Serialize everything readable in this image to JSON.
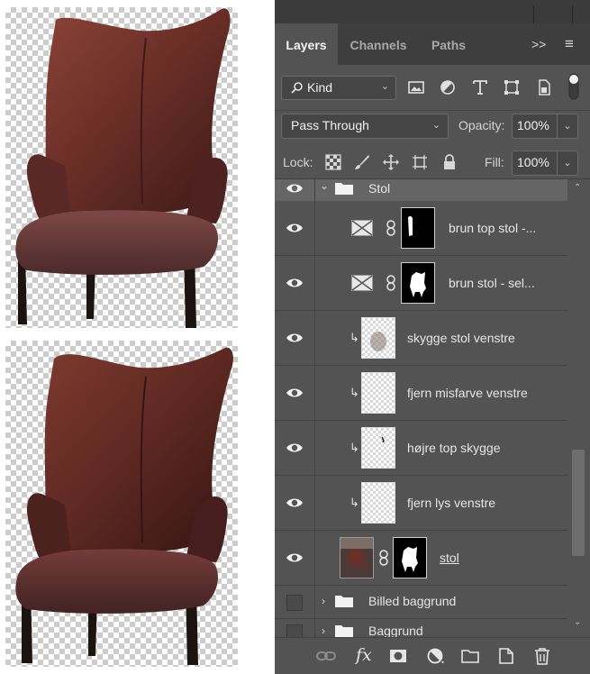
{
  "panel": {
    "tabs": [
      {
        "label": "Layers",
        "active": true
      },
      {
        "label": "Channels",
        "active": false
      },
      {
        "label": "Paths",
        "active": false
      }
    ],
    "tab_icons": [
      ">>",
      "≡"
    ],
    "filter": {
      "label": "Kind",
      "icons": [
        "image-filter-icon",
        "adjustment-filter-icon",
        "type-filter-icon",
        "shape-filter-icon",
        "smart-object-filter-icon",
        "filter-toggle-icon"
      ]
    },
    "blend_mode": "Pass Through",
    "opacity_label": "Opacity:",
    "opacity_value": "100%",
    "lock_label": "Lock:",
    "fill_label": "Fill:",
    "fill_value": "100%",
    "layers": [
      {
        "name": "Stol",
        "kind": "group",
        "visible": true,
        "expanded": true
      },
      {
        "name": "brun top stol -...",
        "kind": "adjustment-masked",
        "visible": true
      },
      {
        "name": "brun stol - sel...",
        "kind": "adjustment-masked",
        "visible": true
      },
      {
        "name": "skygge stol venstre",
        "kind": "clipped",
        "visible": true
      },
      {
        "name": "fjern misfarve venstre",
        "kind": "clipped",
        "visible": true
      },
      {
        "name": "højre top skygge",
        "kind": "clipped",
        "visible": true
      },
      {
        "name": "fjern lys venstre",
        "kind": "clipped",
        "visible": true
      },
      {
        "name": "stol",
        "kind": "image-masked",
        "visible": true
      },
      {
        "name": "Billed baggrund",
        "kind": "group",
        "visible": false,
        "expanded": false
      },
      {
        "name": "Baggrund",
        "kind": "group",
        "visible": false,
        "expanded": false
      }
    ],
    "bottom_icons": [
      "link-layers-icon",
      "fx-icon",
      "add-mask-icon",
      "new-adjustment-icon",
      "new-group-icon",
      "new-layer-icon",
      "delete-layer-icon"
    ],
    "fx_label": "fx"
  },
  "colors": {
    "panel_bg": "#535353",
    "group_row_bg": "#656565",
    "chair_leather": "#6b2f27",
    "chair_legs": "#1c1410"
  }
}
